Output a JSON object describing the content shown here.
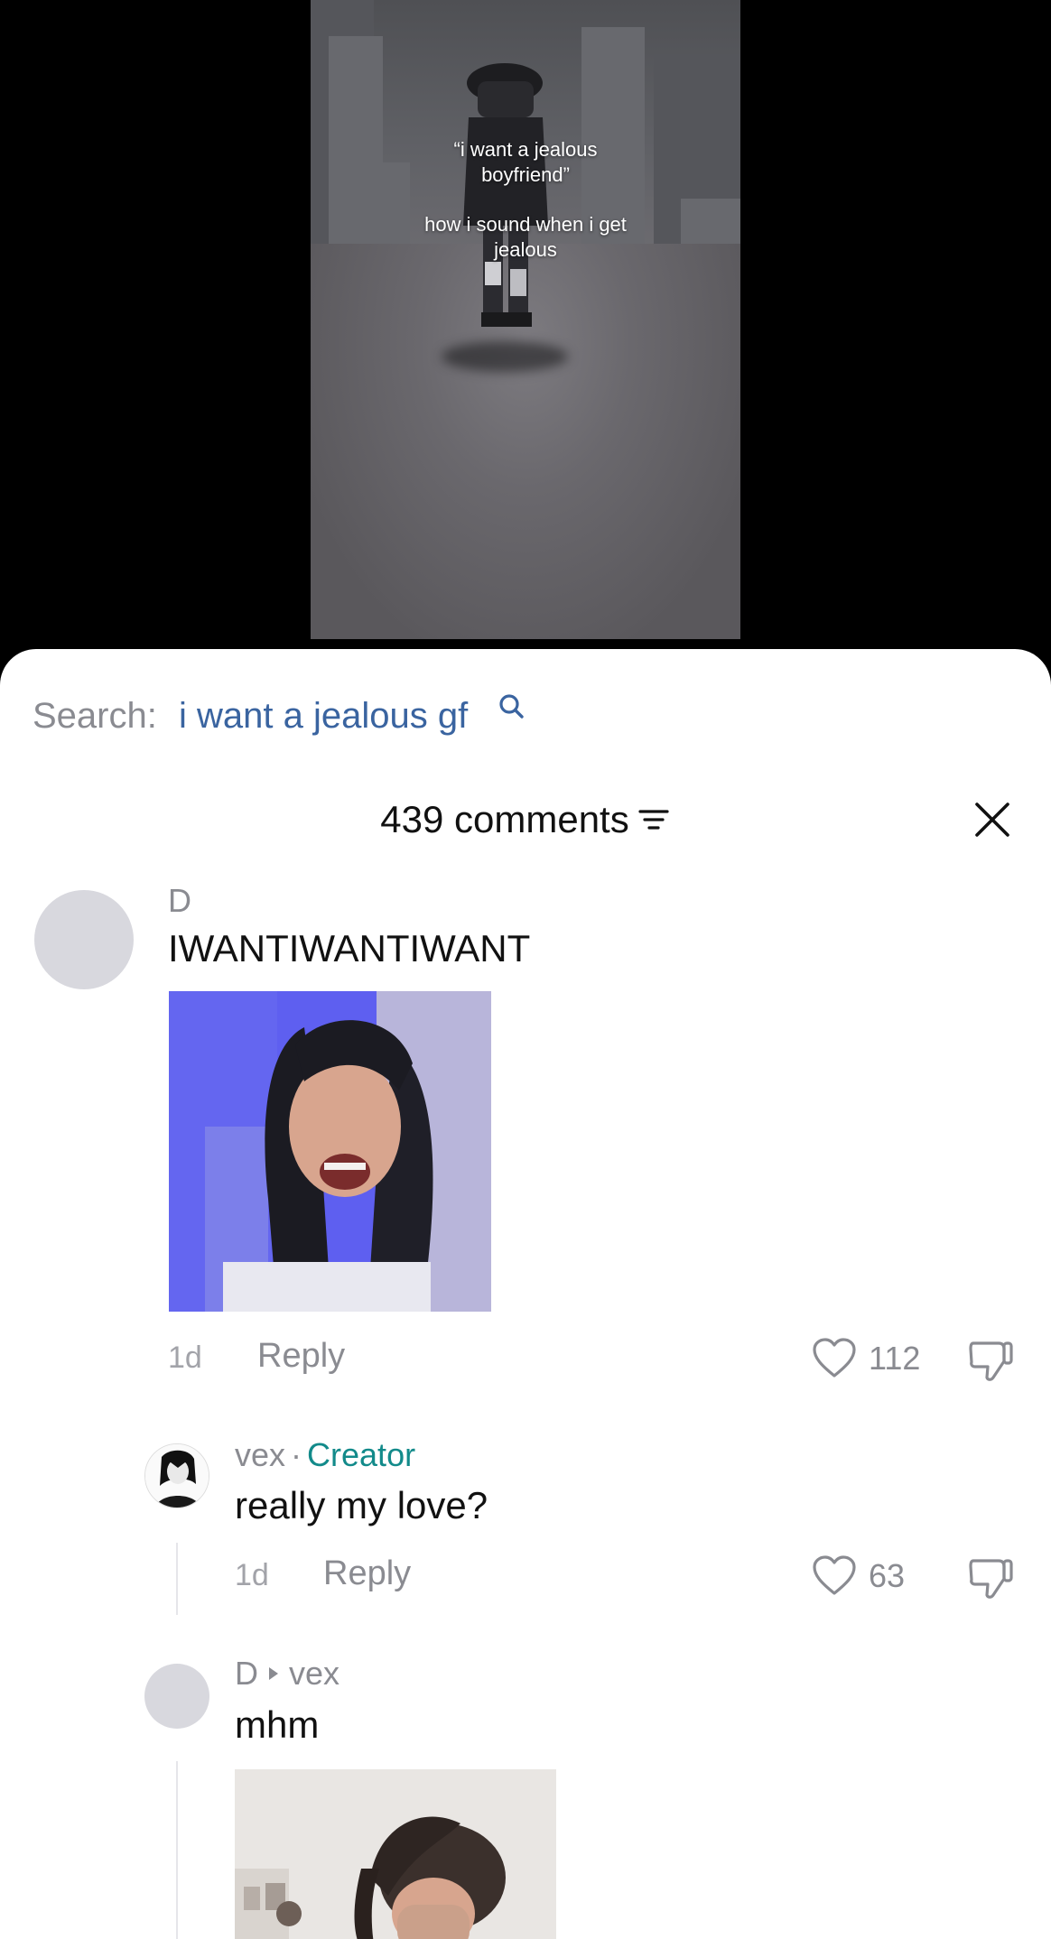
{
  "video": {
    "caption_quote": "\"i want a jealous\nboyfriend\"",
    "caption_line1": "“i want a jealous",
    "caption_line2": "boyfriend”",
    "caption_line3": "how i sound when i get",
    "caption_line4": "jealous"
  },
  "search": {
    "prefix": "Search:",
    "term": "i want a jealous gf",
    "icon": "search-icon"
  },
  "comments_header": {
    "title": "439 comments",
    "filter_icon": "filter-icon",
    "close_icon": "close-icon"
  },
  "comments": [
    {
      "username": "D",
      "text": "IWANTIWANTIWANT",
      "time": "1d",
      "reply_label": "Reply",
      "likes": "112",
      "has_image": true
    }
  ],
  "replies": [
    {
      "username": "vex",
      "separator": "·",
      "badge": "Creator",
      "text": "really my love?",
      "time": "1d",
      "reply_label": "Reply",
      "likes": "63"
    },
    {
      "username": "D",
      "reply_to": "vex",
      "text": "mhm",
      "has_image": true
    }
  ],
  "colors": {
    "link_blue": "#3a64a0",
    "creator_teal": "#128a8a",
    "muted_gray": "#8a8b91"
  }
}
